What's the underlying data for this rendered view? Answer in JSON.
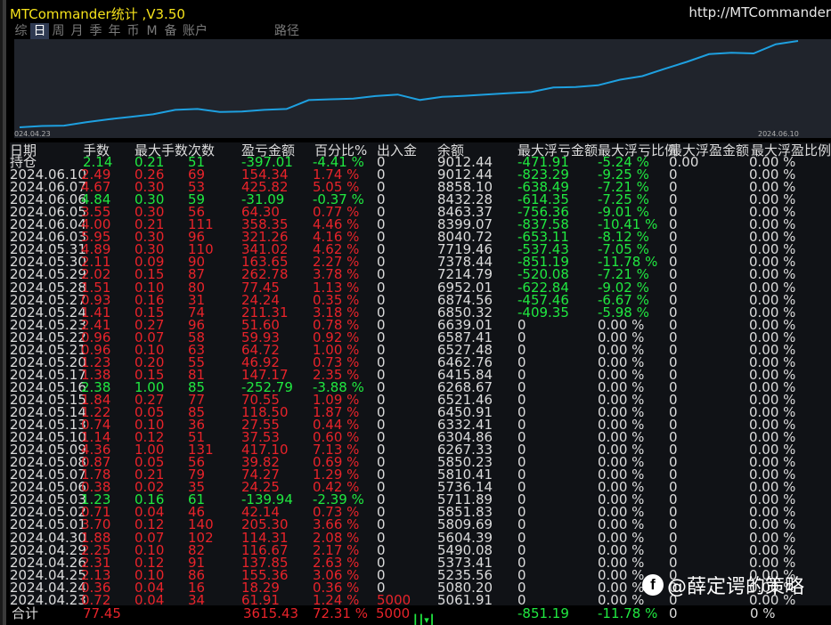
{
  "app": {
    "title": "MTCommander统计 ,V3.50",
    "url": "http://MTCommander"
  },
  "tabs": [
    {
      "label": "综",
      "active": false
    },
    {
      "label": "日",
      "active": true
    },
    {
      "label": "周",
      "active": false
    },
    {
      "label": "月",
      "active": false
    },
    {
      "label": "季",
      "active": false
    },
    {
      "label": "年",
      "active": false
    },
    {
      "label": "币",
      "active": false
    },
    {
      "label": "M",
      "active": false
    },
    {
      "label": "备",
      "active": false
    },
    {
      "label": "账户",
      "active": false
    }
  ],
  "tab_extra": "路径",
  "chart_data": {
    "type": "line",
    "x_start_label": "024.04.23",
    "x_end_label": "2024.06.10",
    "line_color": "#1ea0e0",
    "background": "#20242c",
    "values": [
      5000,
      5061.91,
      5080.2,
      5235.56,
      5373.41,
      5490.08,
      5604.39,
      5809.69,
      5851.83,
      5711.89,
      5736.14,
      5810.41,
      5850.23,
      6267.33,
      6304.86,
      6332.41,
      6450.91,
      6521.46,
      6268.67,
      6415.84,
      6462.76,
      6527.48,
      6587.41,
      6639.01,
      6850.32,
      6874.56,
      6952.01,
      7214.79,
      7378.44,
      7719.46,
      8040.72,
      8399.07,
      8463.37,
      8432.28,
      8858.1,
      9012.44
    ]
  },
  "headers": [
    "日期",
    "手数",
    "最大手数",
    "次数",
    "盈亏金额",
    "百分比%",
    "出入金",
    "余额",
    "最大浮亏金额",
    "最大浮亏比例",
    "最大浮盈金额",
    "最大浮盈比例"
  ],
  "rows": [
    {
      "date": "持仓",
      "lots": "2.14",
      "maxlots": "0.21",
      "count": "51",
      "pnl": "-397.01",
      "pct": "-4.41 %",
      "io": "0",
      "bal": "9012.44",
      "fl": "-471.91",
      "flp": "-5.24 %",
      "fp": "0.00",
      "fpp": "0.00 %",
      "c": "g"
    },
    {
      "date": "2024.06.10",
      "lots": "2.49",
      "maxlots": "0.26",
      "count": "69",
      "pnl": "154.34",
      "pct": "1.74 %",
      "io": "0",
      "bal": "9012.44",
      "fl": "-823.29",
      "flp": "-9.25 %",
      "fp": "0",
      "fpp": "0.00 %",
      "c": "r"
    },
    {
      "date": "2024.06.07",
      "lots": "4.67",
      "maxlots": "0.30",
      "count": "53",
      "pnl": "425.82",
      "pct": "5.05 %",
      "io": "0",
      "bal": "8858.10",
      "fl": "-638.49",
      "flp": "-7.21 %",
      "fp": "0",
      "fpp": "0.00 %",
      "c": "r"
    },
    {
      "date": "2024.06.06",
      "lots": "4.84",
      "maxlots": "0.30",
      "count": "59",
      "pnl": "-31.09",
      "pct": "-0.37 %",
      "io": "0",
      "bal": "8432.28",
      "fl": "-614.35",
      "flp": "-7.25 %",
      "fp": "0",
      "fpp": "0.00 %",
      "c": "g"
    },
    {
      "date": "2024.06.05",
      "lots": "3.55",
      "maxlots": "0.30",
      "count": "56",
      "pnl": "64.30",
      "pct": "0.77 %",
      "io": "0",
      "bal": "8463.37",
      "fl": "-756.36",
      "flp": "-9.01 %",
      "fp": "0",
      "fpp": "0.00 %",
      "c": "r"
    },
    {
      "date": "2024.06.04",
      "lots": "4.00",
      "maxlots": "0.21",
      "count": "111",
      "pnl": "358.35",
      "pct": "4.46 %",
      "io": "0",
      "bal": "8399.07",
      "fl": "-837.58",
      "flp": "-10.41 %",
      "fp": "0",
      "fpp": "0.00 %",
      "c": "r"
    },
    {
      "date": "2024.06.03",
      "lots": "5.95",
      "maxlots": "0.30",
      "count": "96",
      "pnl": "321.26",
      "pct": "4.16 %",
      "io": "0",
      "bal": "8040.72",
      "fl": "-653.11",
      "flp": "-8.12 %",
      "fp": "0",
      "fpp": "0.00 %",
      "c": "r"
    },
    {
      "date": "2024.05.31",
      "lots": "4.89",
      "maxlots": "0.30",
      "count": "110",
      "pnl": "341.02",
      "pct": "4.62 %",
      "io": "0",
      "bal": "7719.46",
      "fl": "-537.43",
      "flp": "-7.05 %",
      "fp": "0",
      "fpp": "0.00 %",
      "c": "r"
    },
    {
      "date": "2024.05.30",
      "lots": "2.11",
      "maxlots": "0.09",
      "count": "90",
      "pnl": "163.65",
      "pct": "2.27 %",
      "io": "0",
      "bal": "7378.44",
      "fl": "-851.19",
      "flp": "-11.78 %",
      "fp": "0",
      "fpp": "0.00 %",
      "c": "r"
    },
    {
      "date": "2024.05.29",
      "lots": "2.02",
      "maxlots": "0.15",
      "count": "87",
      "pnl": "262.78",
      "pct": "3.78 %",
      "io": "0",
      "bal": "7214.79",
      "fl": "-520.08",
      "flp": "-7.21 %",
      "fp": "0",
      "fpp": "0.00 %",
      "c": "r"
    },
    {
      "date": "2024.05.28",
      "lots": "1.51",
      "maxlots": "0.10",
      "count": "80",
      "pnl": "77.45",
      "pct": "1.13 %",
      "io": "0",
      "bal": "6952.01",
      "fl": "-622.84",
      "flp": "-9.02 %",
      "fp": "0",
      "fpp": "0.00 %",
      "c": "r"
    },
    {
      "date": "2024.05.27",
      "lots": "0.93",
      "maxlots": "0.16",
      "count": "31",
      "pnl": "24.24",
      "pct": "0.35 %",
      "io": "0",
      "bal": "6874.56",
      "fl": "-457.46",
      "flp": "-6.67 %",
      "fp": "0",
      "fpp": "0.00 %",
      "c": "r"
    },
    {
      "date": "2024.05.24",
      "lots": "1.41",
      "maxlots": "0.15",
      "count": "74",
      "pnl": "211.31",
      "pct": "3.18 %",
      "io": "0",
      "bal": "6850.32",
      "fl": "-409.35",
      "flp": "-5.98 %",
      "fp": "0",
      "fpp": "0.00 %",
      "c": "r"
    },
    {
      "date": "2024.05.23",
      "lots": "2.41",
      "maxlots": "0.27",
      "count": "96",
      "pnl": "51.60",
      "pct": "0.78 %",
      "io": "0",
      "bal": "6639.01",
      "fl": "0",
      "flp": "0.00 %",
      "fp": "0",
      "fpp": "0.00 %",
      "c": "r"
    },
    {
      "date": "2024.05.22",
      "lots": "0.96",
      "maxlots": "0.07",
      "count": "58",
      "pnl": "59.93",
      "pct": "0.92 %",
      "io": "0",
      "bal": "6587.41",
      "fl": "0",
      "flp": "0.00 %",
      "fp": "0",
      "fpp": "0.00 %",
      "c": "r"
    },
    {
      "date": "2024.05.21",
      "lots": "0.96",
      "maxlots": "0.10",
      "count": "63",
      "pnl": "64.72",
      "pct": "1.00 %",
      "io": "0",
      "bal": "6527.48",
      "fl": "0",
      "flp": "0.00 %",
      "fp": "0",
      "fpp": "0.00 %",
      "c": "r"
    },
    {
      "date": "2024.05.20",
      "lots": "1.23",
      "maxlots": "0.20",
      "count": "55",
      "pnl": "46.92",
      "pct": "0.73 %",
      "io": "0",
      "bal": "6462.76",
      "fl": "0",
      "flp": "0.00 %",
      "fp": "0",
      "fpp": "0.00 %",
      "c": "r"
    },
    {
      "date": "2024.05.17",
      "lots": "1.38",
      "maxlots": "0.15",
      "count": "81",
      "pnl": "147.17",
      "pct": "2.35 %",
      "io": "0",
      "bal": "6415.84",
      "fl": "0",
      "flp": "0.00 %",
      "fp": "0",
      "fpp": "0.00 %",
      "c": "r"
    },
    {
      "date": "2024.05.16",
      "lots": "2.38",
      "maxlots": "1.00",
      "count": "85",
      "pnl": "-252.79",
      "pct": "-3.88 %",
      "io": "0",
      "bal": "6268.67",
      "fl": "0",
      "flp": "0.00 %",
      "fp": "0",
      "fpp": "0.00 %",
      "c": "g"
    },
    {
      "date": "2024.05.15",
      "lots": "1.84",
      "maxlots": "0.27",
      "count": "77",
      "pnl": "70.55",
      "pct": "1.09 %",
      "io": "0",
      "bal": "6521.46",
      "fl": "0",
      "flp": "0.00 %",
      "fp": "0",
      "fpp": "0.00 %",
      "c": "r"
    },
    {
      "date": "2024.05.14",
      "lots": "1.22",
      "maxlots": "0.05",
      "count": "85",
      "pnl": "118.50",
      "pct": "1.87 %",
      "io": "0",
      "bal": "6450.91",
      "fl": "0",
      "flp": "0.00 %",
      "fp": "0",
      "fpp": "0.00 %",
      "c": "r"
    },
    {
      "date": "2024.05.13",
      "lots": "0.74",
      "maxlots": "0.10",
      "count": "36",
      "pnl": "27.55",
      "pct": "0.44 %",
      "io": "0",
      "bal": "6332.41",
      "fl": "0",
      "flp": "0.00 %",
      "fp": "0",
      "fpp": "0.00 %",
      "c": "r"
    },
    {
      "date": "2024.05.10",
      "lots": "1.14",
      "maxlots": "0.12",
      "count": "51",
      "pnl": "37.53",
      "pct": "0.60 %",
      "io": "0",
      "bal": "6304.86",
      "fl": "0",
      "flp": "0.00 %",
      "fp": "0",
      "fpp": "0.00 %",
      "c": "r"
    },
    {
      "date": "2024.05.09",
      "lots": "4.36",
      "maxlots": "1.00",
      "count": "131",
      "pnl": "417.10",
      "pct": "7.13 %",
      "io": "0",
      "bal": "6267.33",
      "fl": "0",
      "flp": "0.00 %",
      "fp": "0",
      "fpp": "0.00 %",
      "c": "r"
    },
    {
      "date": "2024.05.08",
      "lots": "0.87",
      "maxlots": "0.05",
      "count": "56",
      "pnl": "39.82",
      "pct": "0.69 %",
      "io": "0",
      "bal": "5850.23",
      "fl": "0",
      "flp": "0.00 %",
      "fp": "0",
      "fpp": "0.00 %",
      "c": "r"
    },
    {
      "date": "2024.05.07",
      "lots": "1.78",
      "maxlots": "0.21",
      "count": "79",
      "pnl": "74.27",
      "pct": "1.29 %",
      "io": "0",
      "bal": "5810.41",
      "fl": "0",
      "flp": "0.00 %",
      "fp": "0",
      "fpp": "0.00 %",
      "c": "r"
    },
    {
      "date": "2024.05.06",
      "lots": "0.38",
      "maxlots": "0.02",
      "count": "35",
      "pnl": "24.25",
      "pct": "0.42 %",
      "io": "0",
      "bal": "5736.14",
      "fl": "0",
      "flp": "0.00 %",
      "fp": "0",
      "fpp": "0.00 %",
      "c": "r"
    },
    {
      "date": "2024.05.03",
      "lots": "1.23",
      "maxlots": "0.16",
      "count": "61",
      "pnl": "-139.94",
      "pct": "-2.39 %",
      "io": "0",
      "bal": "5711.89",
      "fl": "0",
      "flp": "0.00 %",
      "fp": "0",
      "fpp": "0.00 %",
      "c": "g"
    },
    {
      "date": "2024.05.02",
      "lots": "0.71",
      "maxlots": "0.04",
      "count": "46",
      "pnl": "42.14",
      "pct": "0.73 %",
      "io": "0",
      "bal": "5851.83",
      "fl": "0",
      "flp": "0.00 %",
      "fp": "0",
      "fpp": "0.00 %",
      "c": "r"
    },
    {
      "date": "2024.05.01",
      "lots": "3.70",
      "maxlots": "0.12",
      "count": "140",
      "pnl": "205.30",
      "pct": "3.66 %",
      "io": "0",
      "bal": "5809.69",
      "fl": "0",
      "flp": "0.00 %",
      "fp": "0",
      "fpp": "0.00 %",
      "c": "r"
    },
    {
      "date": "2024.04.30",
      "lots": "1.88",
      "maxlots": "0.07",
      "count": "102",
      "pnl": "114.31",
      "pct": "2.08 %",
      "io": "0",
      "bal": "5604.39",
      "fl": "0",
      "flp": "0.00 %",
      "fp": "0",
      "fpp": "0.00 %",
      "c": "r"
    },
    {
      "date": "2024.04.29",
      "lots": "2.25",
      "maxlots": "0.10",
      "count": "82",
      "pnl": "116.67",
      "pct": "2.17 %",
      "io": "0",
      "bal": "5490.08",
      "fl": "0",
      "flp": "0.00 %",
      "fp": "0",
      "fpp": "0.00 %",
      "c": "r"
    },
    {
      "date": "2024.04.26",
      "lots": "2.31",
      "maxlots": "0.12",
      "count": "91",
      "pnl": "137.85",
      "pct": "2.63 %",
      "io": "0",
      "bal": "5373.41",
      "fl": "0",
      "flp": "0.00 %",
      "fp": "0",
      "fpp": "0.00 %",
      "c": "r"
    },
    {
      "date": "2024.04.25",
      "lots": "2.13",
      "maxlots": "0.10",
      "count": "86",
      "pnl": "155.36",
      "pct": "3.06 %",
      "io": "0",
      "bal": "5235.56",
      "fl": "0",
      "flp": "0.00 %",
      "fp": "0",
      "fpp": "0.00 %",
      "c": "r"
    },
    {
      "date": "2024.04.24",
      "lots": "0.36",
      "maxlots": "0.04",
      "count": "16",
      "pnl": "18.29",
      "pct": "0.36 %",
      "io": "0",
      "bal": "5080.20",
      "fl": "0",
      "flp": "0.00 %",
      "fp": "0",
      "fpp": "0.00 %",
      "c": "r"
    },
    {
      "date": "2024.04.23",
      "lots": "0.72",
      "maxlots": "0.04",
      "count": "34",
      "pnl": "61.91",
      "pct": "1.24 %",
      "io": "5000",
      "bal": "5061.91",
      "fl": "0",
      "flp": "0.00 %",
      "fp": "0",
      "fpp": "0.00 %",
      "c": "r"
    }
  ],
  "total": {
    "label": "合计",
    "lots": "77.45",
    "pnl": "3615.43",
    "pct": "72.31 %",
    "io": "5000",
    "fl": "-851.19",
    "flp": "-11.78 %",
    "fp": "0",
    "fpp": "0 %"
  },
  "watermark": {
    "logo": "f",
    "text": "@薛定谔的策略"
  }
}
